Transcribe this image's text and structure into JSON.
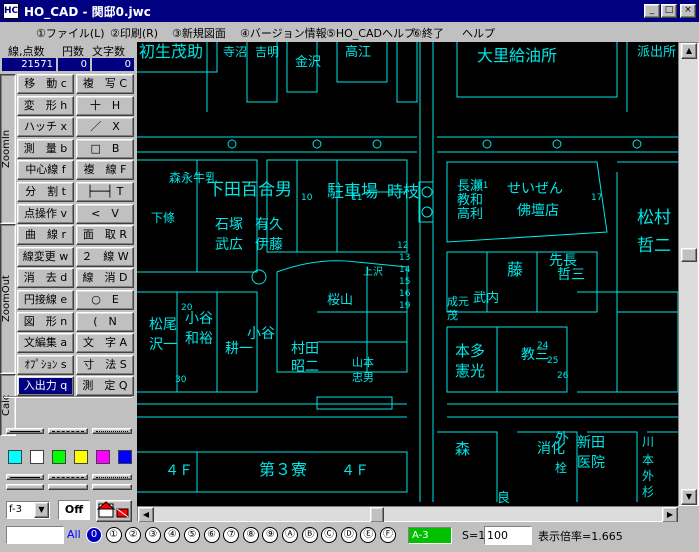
{
  "window": {
    "app_icon": "HC",
    "title": "HO_CAD - 関邸0.jwc",
    "minimize": "_",
    "maximize": "□",
    "close": "×"
  },
  "menu": [
    "①ファイル(L)",
    "②印刷(R)",
    "③新規図面",
    "④バージョン情報",
    "⑤HO_CADヘルプ",
    "⑥終了",
    "ヘルプ"
  ],
  "counters": {
    "labels": [
      "線,点数",
      "円数",
      "文字数"
    ],
    "values": [
      "21571",
      "0",
      "0"
    ]
  },
  "side_tabs": [
    "ZoomIn",
    "ZoomOut",
    "Calc"
  ],
  "commands": [
    [
      "移　動 c",
      "複　写 C"
    ],
    [
      "変　形 h",
      "十　H"
    ],
    [
      "ハッチ x",
      "／　X"
    ],
    [
      "測　量 b",
      "□　B"
    ],
    [
      "中心線 f",
      "複　線 F"
    ],
    [
      "分　割 t",
      "├──┤ T"
    ],
    [
      "点操作 v",
      "<　V"
    ],
    [
      "曲　線 r",
      "面　取 R"
    ],
    [
      "線変更 w",
      "２　線 W"
    ],
    [
      "消　去 d",
      "線　消 D"
    ],
    [
      "円接線 e",
      "○　E"
    ],
    [
      "図　形 n",
      "(　N"
    ],
    [
      "文編集 a",
      "文　字 A"
    ],
    [
      "ｵﾌﾟｼｮﾝ s",
      "寸　法 S"
    ],
    [
      "入出力 q",
      "測　定 Q"
    ]
  ],
  "colors": [
    "#00ffff",
    "#ffffff",
    "#00ff00",
    "#ffff00",
    "#ff00ff",
    "#0000ff"
  ],
  "map_color": "#00e5e5",
  "layer_select": "f-3",
  "off_label": "Off",
  "tool_icons": [
    "home-icon",
    "text-style-icon",
    "points-icon",
    "diagonal-line-icon",
    "grid-icon"
  ],
  "points_label": "測点",
  "grid_label": "O",
  "status": {
    "all_label": "All",
    "layers": [
      "0",
      "①",
      "②",
      "③",
      "④",
      "⑤",
      "⑥",
      "⑦",
      "⑧",
      "⑨",
      "Ⓐ",
      "Ⓑ",
      "Ⓒ",
      "Ⓓ",
      "Ⓔ",
      "Ⓕ"
    ],
    "layer_group": "A-3",
    "scale_label": "S=1:",
    "scale_value": "100",
    "zoom_text": "表示倍率=1.665"
  },
  "map_labels": [
    "初生茂助",
    "寺沼",
    "吉明",
    "金沢",
    "高江",
    "大里給油所",
    "派出所",
    "下田百合男",
    "駐車場",
    "時枝",
    "せいぜん",
    "佛壇店",
    "長瀬",
    "教和",
    "高利",
    "松村",
    "哲二",
    "森永牛乳",
    "下條",
    "石塚",
    "武広",
    "有久",
    "伊藤",
    "桜山",
    "上沢",
    "武内",
    "成元",
    "茂",
    "藤",
    "先長",
    "哲三",
    "松尾",
    "沢一",
    "小谷",
    "和裕",
    "小谷",
    "耕一",
    "村田",
    "昭二",
    "山本",
    "忠男",
    "本多",
    "憲光",
    "教三",
    "第３寮",
    "４Ｆ",
    "４Ｆ",
    "森",
    "消化",
    "外",
    "栓",
    "新田",
    "医院",
    "川",
    "本",
    "外",
    "杉",
    "良",
    "17",
    "20",
    "30",
    "12",
    "13",
    "14",
    "15",
    "16",
    "19",
    "10",
    "11",
    "21",
    "24",
    "25",
    "26"
  ]
}
